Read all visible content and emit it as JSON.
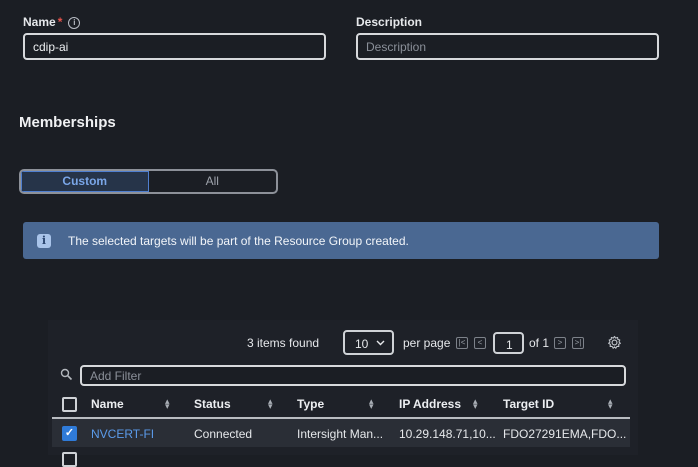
{
  "form": {
    "name_label": "Name",
    "name_required_mark": "*",
    "name_info_glyph": "i",
    "name_value": "cdip-ai",
    "description_label": "Description",
    "description_placeholder": "Description"
  },
  "memberships": {
    "title": "Memberships",
    "options": [
      "Custom",
      "All"
    ],
    "selected": "Custom"
  },
  "banner": {
    "icon": "info-icon",
    "text": "The selected targets will be part of the Resource Group created."
  },
  "table": {
    "items_found": "3 items found",
    "page_size": "10",
    "per_page_label": "per page",
    "page_number": "1",
    "page_total": "of 1",
    "filter_placeholder": "Add Filter",
    "columns": [
      "Name",
      "Status",
      "Type",
      "IP Address",
      "Target ID"
    ],
    "rows": [
      {
        "checked": true,
        "name": "NVCERT-FI",
        "status": "Connected",
        "type": "Intersight Man...",
        "ip": "10.29.148.71,10...",
        "target_id": "FDO27291EMA,FDO..."
      }
    ]
  },
  "colors": {
    "background": "#1b1e24",
    "accent": "#2f7bd9",
    "link": "#5b9bea",
    "banner": "#4a6892",
    "required": "#e5534b"
  }
}
